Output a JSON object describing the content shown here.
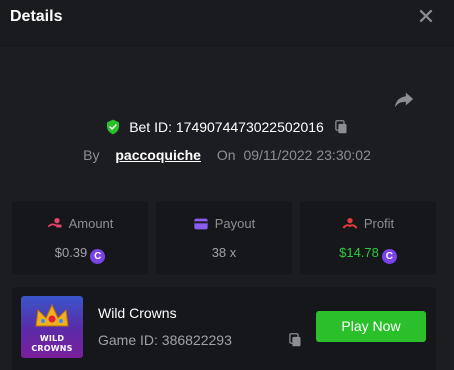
{
  "header": {
    "title": "Details"
  },
  "bet": {
    "id_label": "Bet ID:",
    "id_value": "1749074473022502016",
    "by_label": "By",
    "username": "paccoquiche",
    "on_label": "On",
    "datetime": "09/11/2022 23:30:02"
  },
  "stats": {
    "amount": {
      "label": "Amount",
      "value": "$0.39",
      "coin": "C"
    },
    "payout": {
      "label": "Payout",
      "value": "38 x"
    },
    "profit": {
      "label": "Profit",
      "value": "$14.78",
      "coin": "C"
    }
  },
  "game": {
    "name": "Wild Crowns",
    "id_text": "Game ID: 386822293",
    "thumb_line1": "WILD",
    "thumb_line2": "CROWNS",
    "play_label": "Play Now"
  },
  "colors": {
    "background": "#1c1d22",
    "card": "#16171b",
    "accent_green": "#2bc02b",
    "profit_green": "#2ec93c",
    "coin_purple": "#7a43e8",
    "amount_icon": "#e8436a",
    "payout_icon": "#8a5cf0",
    "profit_icon": "#e83a3a"
  },
  "icons": [
    "close-icon",
    "share-icon",
    "shield-check-icon",
    "copy-icon",
    "amount-icon",
    "payout-icon",
    "profit-icon",
    "coin-icon"
  ]
}
